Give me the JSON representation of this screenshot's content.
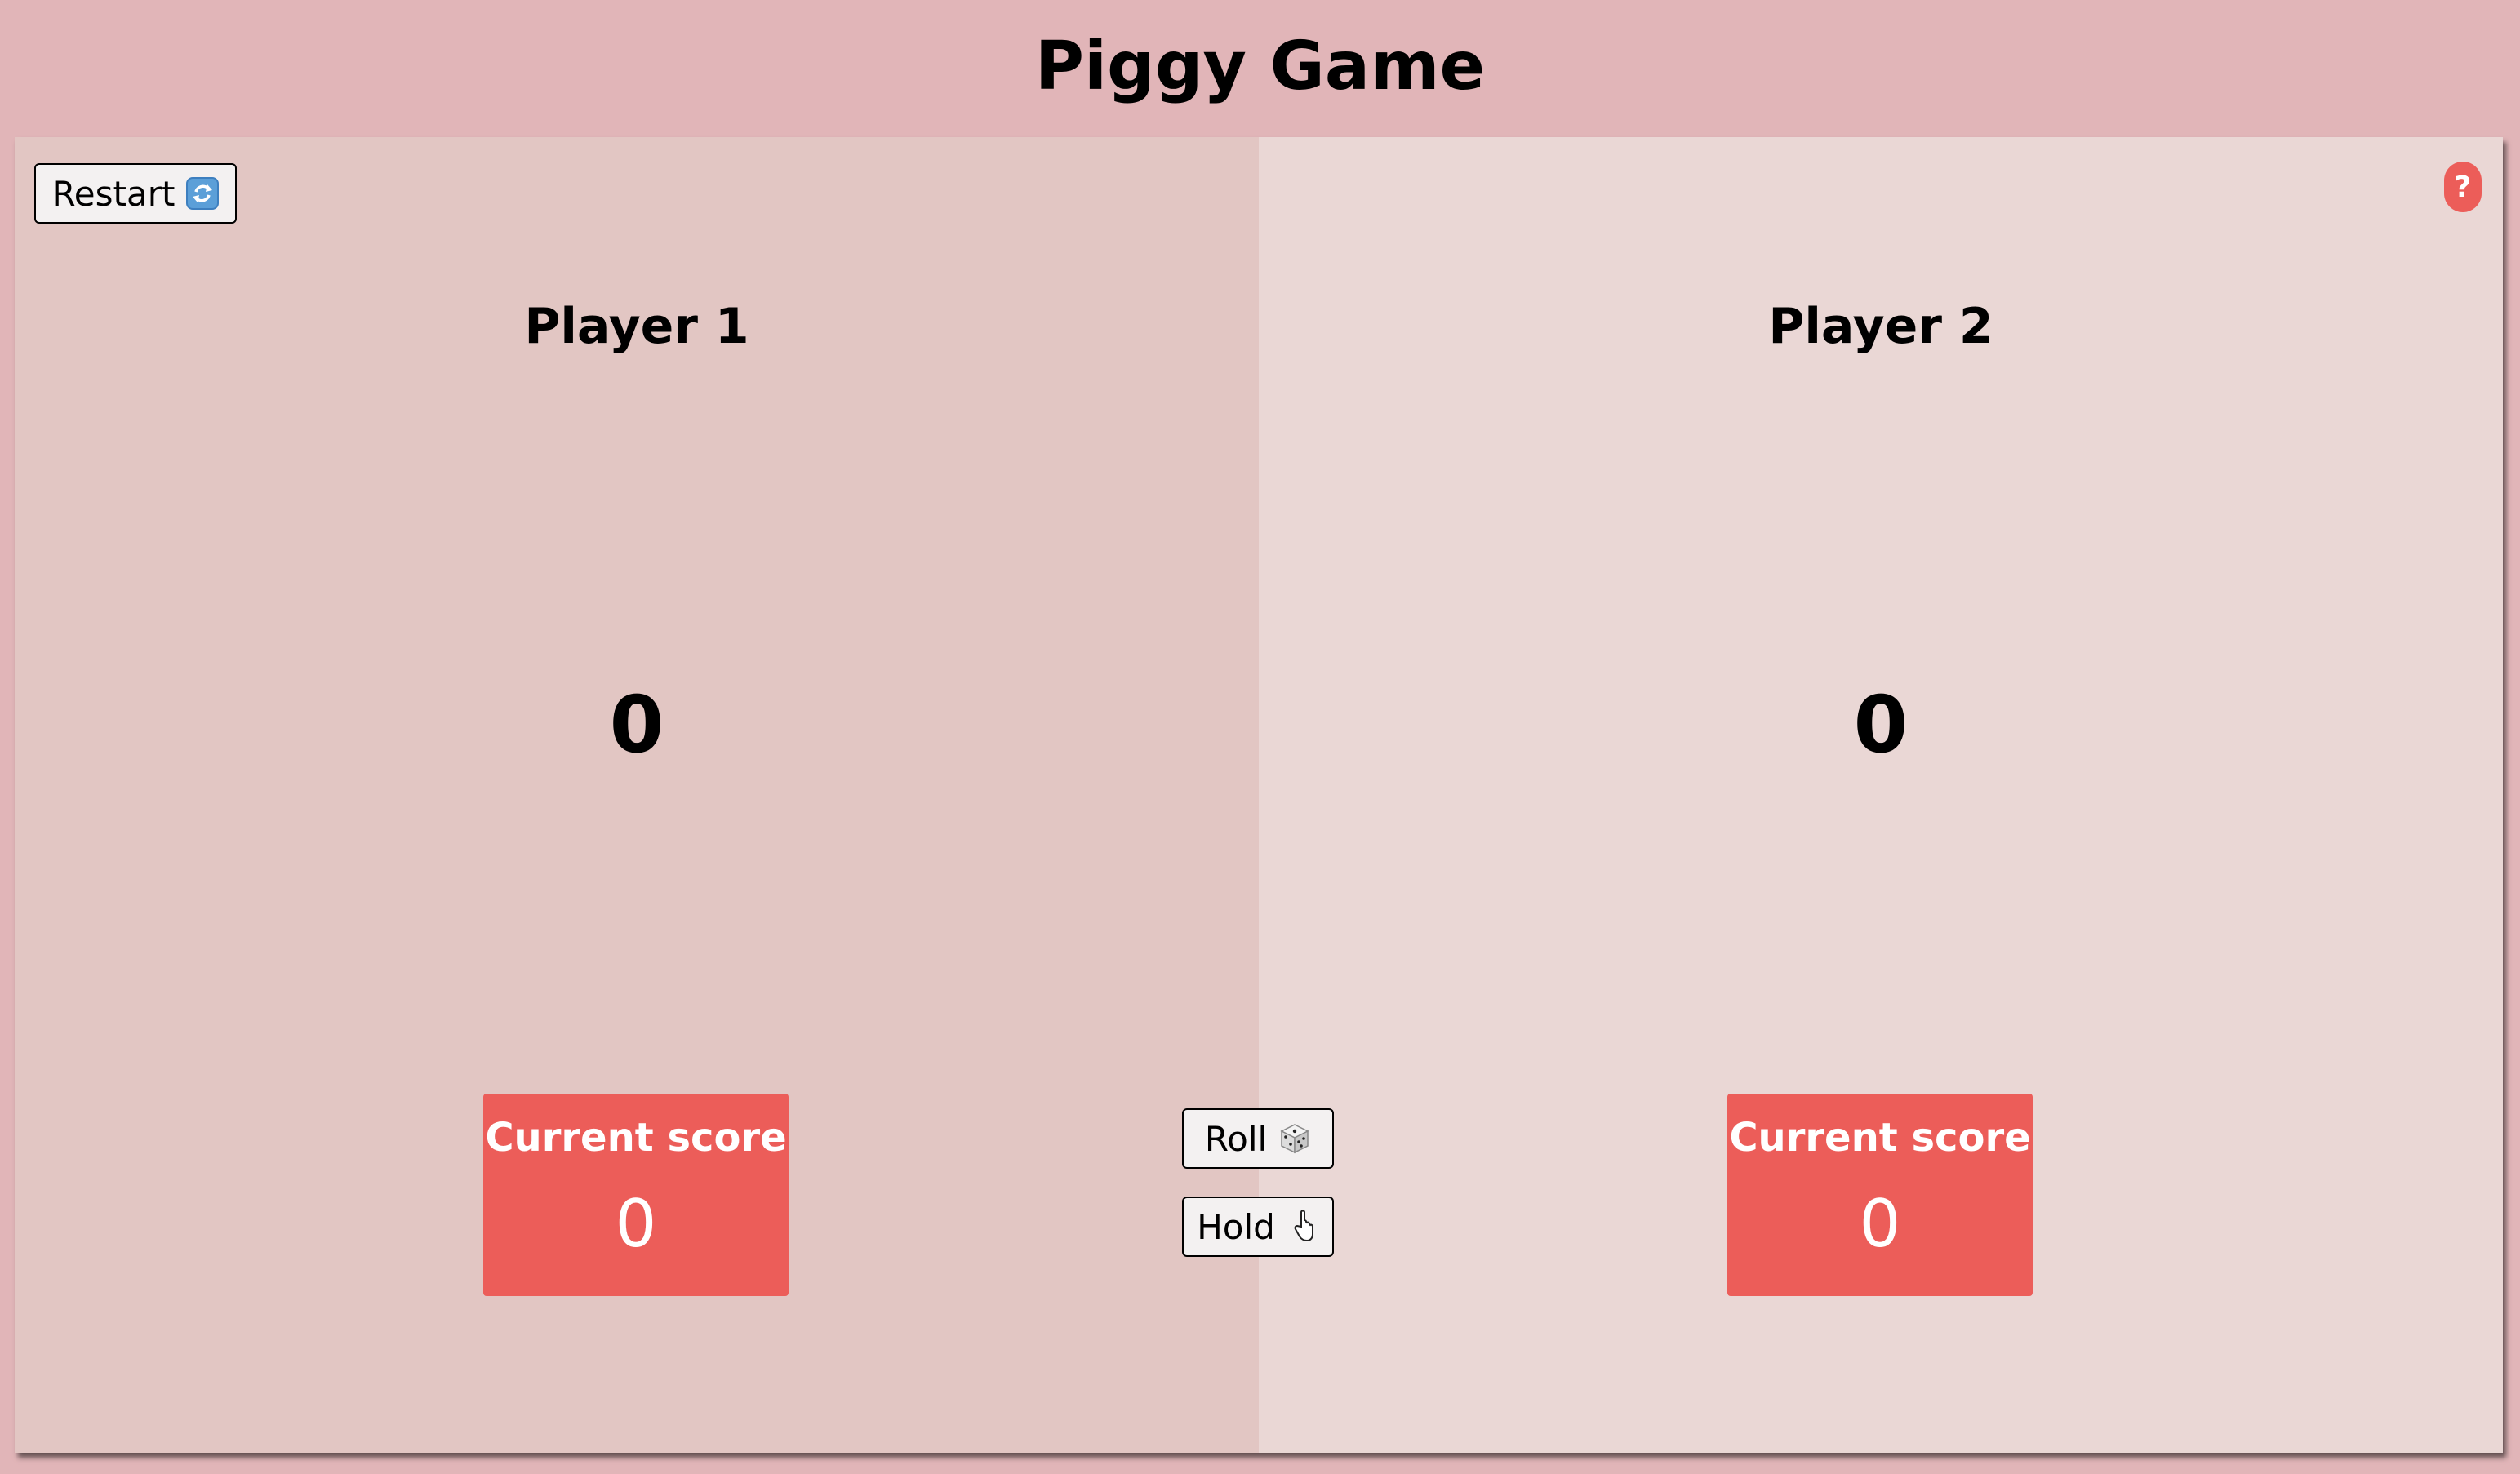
{
  "page": {
    "title": "Piggy Game"
  },
  "controls": {
    "restart_label": "Restart",
    "restart_icon": "refresh-icon",
    "roll_label": "Roll",
    "roll_icon": "die-icon",
    "hold_label": "Hold",
    "hold_icon": "pointing-hand-icon",
    "help_label": "?"
  },
  "players": [
    {
      "name": "Player 1",
      "total_score": "0",
      "current_label": "Current score",
      "current_score": "0"
    },
    {
      "name": "Player 2",
      "total_score": "0",
      "current_label": "Current score",
      "current_score": "0"
    }
  ],
  "colors": {
    "background": "#e1b5b8",
    "panel_active": "#e2c6c3",
    "panel_inactive": "#ead7d5",
    "accent": "#ec5d59"
  }
}
